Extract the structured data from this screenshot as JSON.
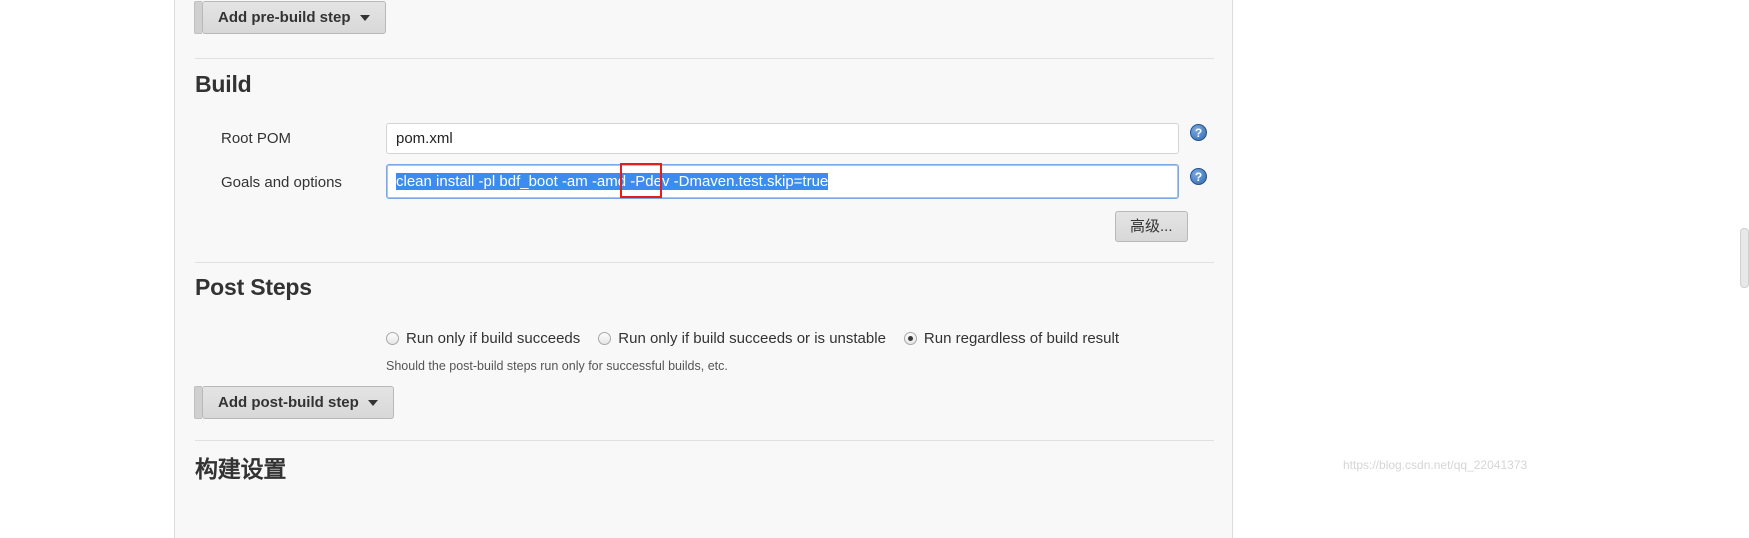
{
  "theme": {
    "panel_bg": "#f8f8f8",
    "accent_blue": "#3c8cf0",
    "annotation_red": "#e02020",
    "text": "#333333"
  },
  "prebuild": {
    "add_step_label": "Add pre-build step"
  },
  "build": {
    "section_title": "Build",
    "root_pom": {
      "label": "Root POM",
      "value": "pom.xml",
      "help_glyph": "?"
    },
    "goals": {
      "label": "Goals and options",
      "value": "clean install -pl bdf_boot -am -amd -Pdev -Dmaven.test.skip=true",
      "highlighted": true,
      "annotated_token": "-Pdev",
      "help_glyph": "?"
    },
    "advanced_button": "高级..."
  },
  "post_steps": {
    "section_title": "Post Steps",
    "options": [
      {
        "label": "Run only if build succeeds",
        "selected": false
      },
      {
        "label": "Run only if build succeeds or is unstable",
        "selected": false
      },
      {
        "label": "Run regardless of build result",
        "selected": true
      }
    ],
    "hint": "Should the post-build steps run only for successful builds, etc.",
    "add_step_label": "Add post-build step"
  },
  "build_settings": {
    "section_title": "构建设置"
  },
  "watermark": {
    "text": "https://blog.csdn.net/qq_22041373"
  }
}
